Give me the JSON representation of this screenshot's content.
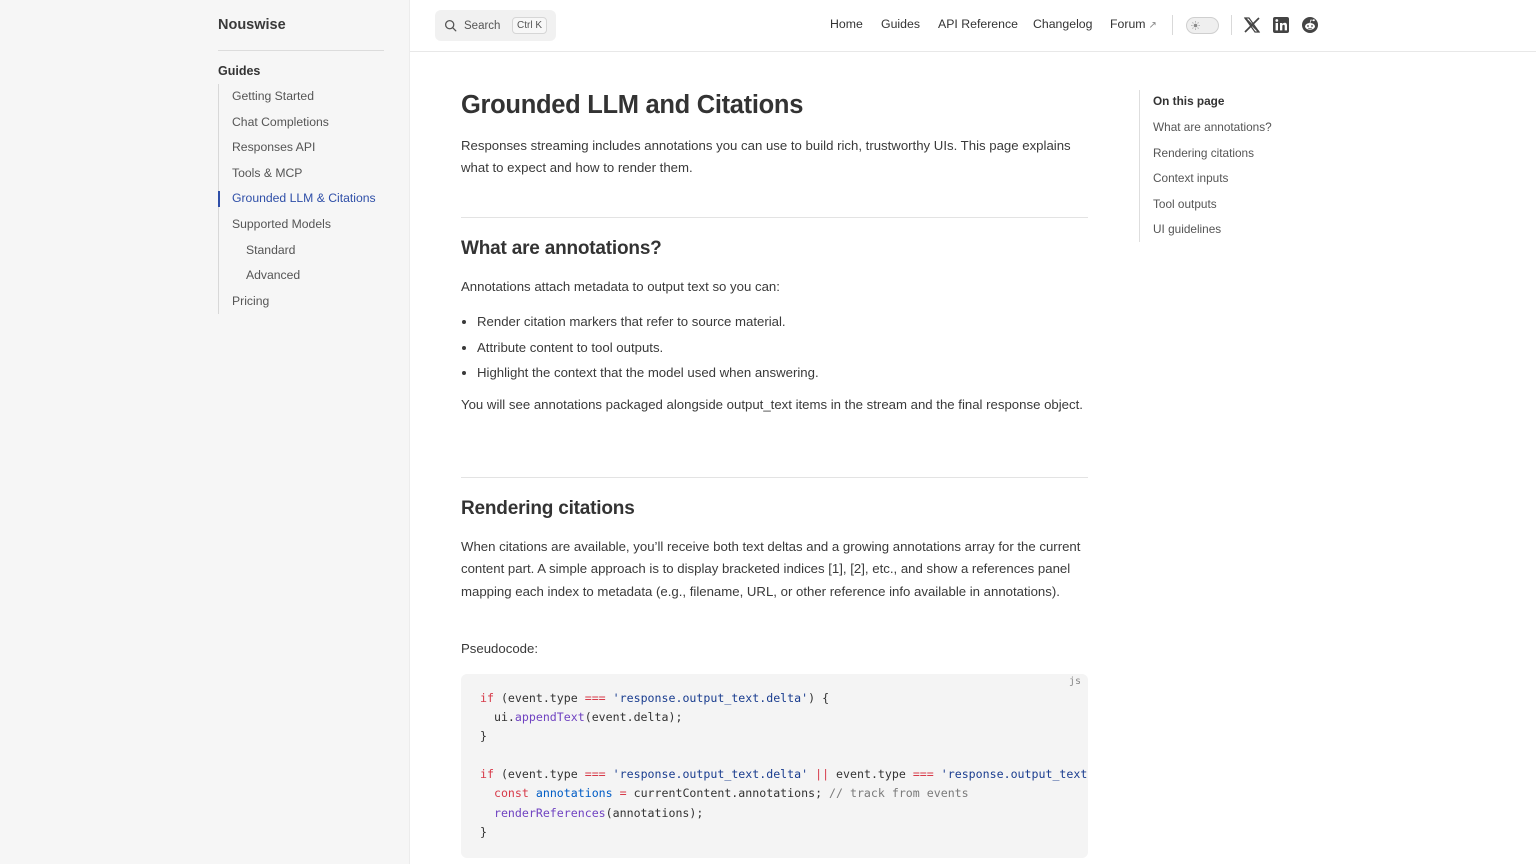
{
  "sidebar": {
    "brand": "Nouswise",
    "section_title": "Guides",
    "items": [
      {
        "label": "Getting Started"
      },
      {
        "label": "Chat Completions"
      },
      {
        "label": "Responses API"
      },
      {
        "label": "Tools & MCP"
      },
      {
        "label": "Grounded LLM & Citations",
        "active": true
      },
      {
        "label": "Supported Models"
      },
      {
        "label": "Standard",
        "sub": true
      },
      {
        "label": "Advanced",
        "sub": true
      },
      {
        "label": "Pricing"
      }
    ]
  },
  "header": {
    "search_label": "Search",
    "search_shortcut": "Ctrl K",
    "nav": {
      "home": "Home",
      "guides": "Guides",
      "api_reference": "API Reference",
      "changelog": "Changelog",
      "forum": "Forum",
      "forum_arrow": "↗"
    },
    "icons": [
      "sun-icon",
      "x-icon",
      "linkedin-icon",
      "reddit-icon"
    ]
  },
  "main": {
    "title": "Grounded LLM and Citations",
    "intro": "Responses streaming includes annotations you can use to build rich, trustworthy UIs. This page explains what to expect and how to render them.",
    "section1": {
      "heading": "What are annotations?",
      "lead": "Annotations attach metadata to output text so you can:",
      "bullets": [
        "Render citation markers that refer to source material.",
        "Attribute content to tool outputs.",
        "Highlight the context that the model used when answering."
      ],
      "after": "You will see annotations packaged alongside output_text items in the stream and the final response object."
    },
    "section2": {
      "heading": "Rendering citations",
      "body": "When citations are available, you’ll receive both text deltas and a growing annotations array for the current content part. A simple approach is to display bracketed indices [1], [2], etc., and show a references panel mapping each index to metadata (e.g., filename, URL, or other reference info available in annotations).",
      "pseudocode_label": "Pseudocode:"
    },
    "code": {
      "lang": "js",
      "line1": {
        "kw": "if",
        "a": " (event.type ",
        "op": "===",
        "b": " ",
        "str": "'response.output_text.delta'",
        "c": ") {"
      },
      "line2": {
        "a": "  ui.",
        "fn": "appendText",
        "b": "(event.delta);"
      },
      "line3": "}",
      "line5": {
        "kw": "if",
        "a": " (event.type ",
        "op1": "===",
        "b": " ",
        "str1": "'response.output_text.delta'",
        "c": " ",
        "op2": "||",
        "d": " event.type ",
        "op3": "===",
        "e": " ",
        "str2": "'response.output_text.done'",
        "f": ") {"
      },
      "line6": {
        "a": "  ",
        "kw": "const",
        "b": " ",
        "var": "annotations",
        "c": " ",
        "op": "=",
        "d": " currentContent.annotations; ",
        "cm": "// track from events"
      },
      "line7": {
        "a": "  ",
        "fn": "renderReferences",
        "b": "(annotations);"
      },
      "line8": "}"
    }
  },
  "toc": {
    "title": "On this page",
    "items": [
      "What are annotations?",
      "Rendering citations",
      "Context inputs",
      "Tool outputs",
      "UI guidelines"
    ]
  }
}
